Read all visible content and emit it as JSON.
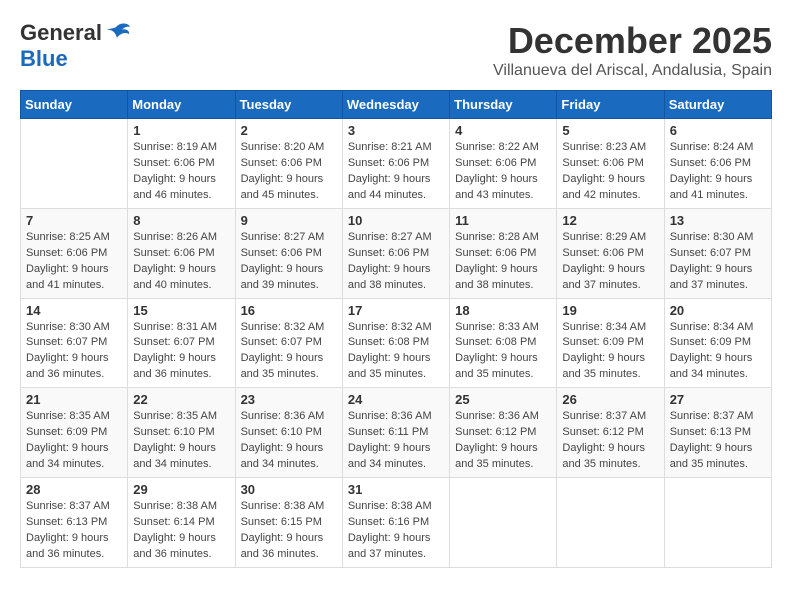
{
  "logo": {
    "general": "General",
    "blue": "Blue"
  },
  "title": {
    "month": "December 2025",
    "location": "Villanueva del Ariscal, Andalusia, Spain"
  },
  "weekdays": [
    "Sunday",
    "Monday",
    "Tuesday",
    "Wednesday",
    "Thursday",
    "Friday",
    "Saturday"
  ],
  "weeks": [
    [
      {
        "day": "",
        "info": ""
      },
      {
        "day": "1",
        "info": "Sunrise: 8:19 AM\nSunset: 6:06 PM\nDaylight: 9 hours\nand 46 minutes."
      },
      {
        "day": "2",
        "info": "Sunrise: 8:20 AM\nSunset: 6:06 PM\nDaylight: 9 hours\nand 45 minutes."
      },
      {
        "day": "3",
        "info": "Sunrise: 8:21 AM\nSunset: 6:06 PM\nDaylight: 9 hours\nand 44 minutes."
      },
      {
        "day": "4",
        "info": "Sunrise: 8:22 AM\nSunset: 6:06 PM\nDaylight: 9 hours\nand 43 minutes."
      },
      {
        "day": "5",
        "info": "Sunrise: 8:23 AM\nSunset: 6:06 PM\nDaylight: 9 hours\nand 42 minutes."
      },
      {
        "day": "6",
        "info": "Sunrise: 8:24 AM\nSunset: 6:06 PM\nDaylight: 9 hours\nand 41 minutes."
      }
    ],
    [
      {
        "day": "7",
        "info": "Sunrise: 8:25 AM\nSunset: 6:06 PM\nDaylight: 9 hours\nand 41 minutes."
      },
      {
        "day": "8",
        "info": "Sunrise: 8:26 AM\nSunset: 6:06 PM\nDaylight: 9 hours\nand 40 minutes."
      },
      {
        "day": "9",
        "info": "Sunrise: 8:27 AM\nSunset: 6:06 PM\nDaylight: 9 hours\nand 39 minutes."
      },
      {
        "day": "10",
        "info": "Sunrise: 8:27 AM\nSunset: 6:06 PM\nDaylight: 9 hours\nand 38 minutes."
      },
      {
        "day": "11",
        "info": "Sunrise: 8:28 AM\nSunset: 6:06 PM\nDaylight: 9 hours\nand 38 minutes."
      },
      {
        "day": "12",
        "info": "Sunrise: 8:29 AM\nSunset: 6:06 PM\nDaylight: 9 hours\nand 37 minutes."
      },
      {
        "day": "13",
        "info": "Sunrise: 8:30 AM\nSunset: 6:07 PM\nDaylight: 9 hours\nand 37 minutes."
      }
    ],
    [
      {
        "day": "14",
        "info": "Sunrise: 8:30 AM\nSunset: 6:07 PM\nDaylight: 9 hours\nand 36 minutes."
      },
      {
        "day": "15",
        "info": "Sunrise: 8:31 AM\nSunset: 6:07 PM\nDaylight: 9 hours\nand 36 minutes."
      },
      {
        "day": "16",
        "info": "Sunrise: 8:32 AM\nSunset: 6:07 PM\nDaylight: 9 hours\nand 35 minutes."
      },
      {
        "day": "17",
        "info": "Sunrise: 8:32 AM\nSunset: 6:08 PM\nDaylight: 9 hours\nand 35 minutes."
      },
      {
        "day": "18",
        "info": "Sunrise: 8:33 AM\nSunset: 6:08 PM\nDaylight: 9 hours\nand 35 minutes."
      },
      {
        "day": "19",
        "info": "Sunrise: 8:34 AM\nSunset: 6:09 PM\nDaylight: 9 hours\nand 35 minutes."
      },
      {
        "day": "20",
        "info": "Sunrise: 8:34 AM\nSunset: 6:09 PM\nDaylight: 9 hours\nand 34 minutes."
      }
    ],
    [
      {
        "day": "21",
        "info": "Sunrise: 8:35 AM\nSunset: 6:09 PM\nDaylight: 9 hours\nand 34 minutes."
      },
      {
        "day": "22",
        "info": "Sunrise: 8:35 AM\nSunset: 6:10 PM\nDaylight: 9 hours\nand 34 minutes."
      },
      {
        "day": "23",
        "info": "Sunrise: 8:36 AM\nSunset: 6:10 PM\nDaylight: 9 hours\nand 34 minutes."
      },
      {
        "day": "24",
        "info": "Sunrise: 8:36 AM\nSunset: 6:11 PM\nDaylight: 9 hours\nand 34 minutes."
      },
      {
        "day": "25",
        "info": "Sunrise: 8:36 AM\nSunset: 6:12 PM\nDaylight: 9 hours\nand 35 minutes."
      },
      {
        "day": "26",
        "info": "Sunrise: 8:37 AM\nSunset: 6:12 PM\nDaylight: 9 hours\nand 35 minutes."
      },
      {
        "day": "27",
        "info": "Sunrise: 8:37 AM\nSunset: 6:13 PM\nDaylight: 9 hours\nand 35 minutes."
      }
    ],
    [
      {
        "day": "28",
        "info": "Sunrise: 8:37 AM\nSunset: 6:13 PM\nDaylight: 9 hours\nand 36 minutes."
      },
      {
        "day": "29",
        "info": "Sunrise: 8:38 AM\nSunset: 6:14 PM\nDaylight: 9 hours\nand 36 minutes."
      },
      {
        "day": "30",
        "info": "Sunrise: 8:38 AM\nSunset: 6:15 PM\nDaylight: 9 hours\nand 36 minutes."
      },
      {
        "day": "31",
        "info": "Sunrise: 8:38 AM\nSunset: 6:16 PM\nDaylight: 9 hours\nand 37 minutes."
      },
      {
        "day": "",
        "info": ""
      },
      {
        "day": "",
        "info": ""
      },
      {
        "day": "",
        "info": ""
      }
    ]
  ]
}
